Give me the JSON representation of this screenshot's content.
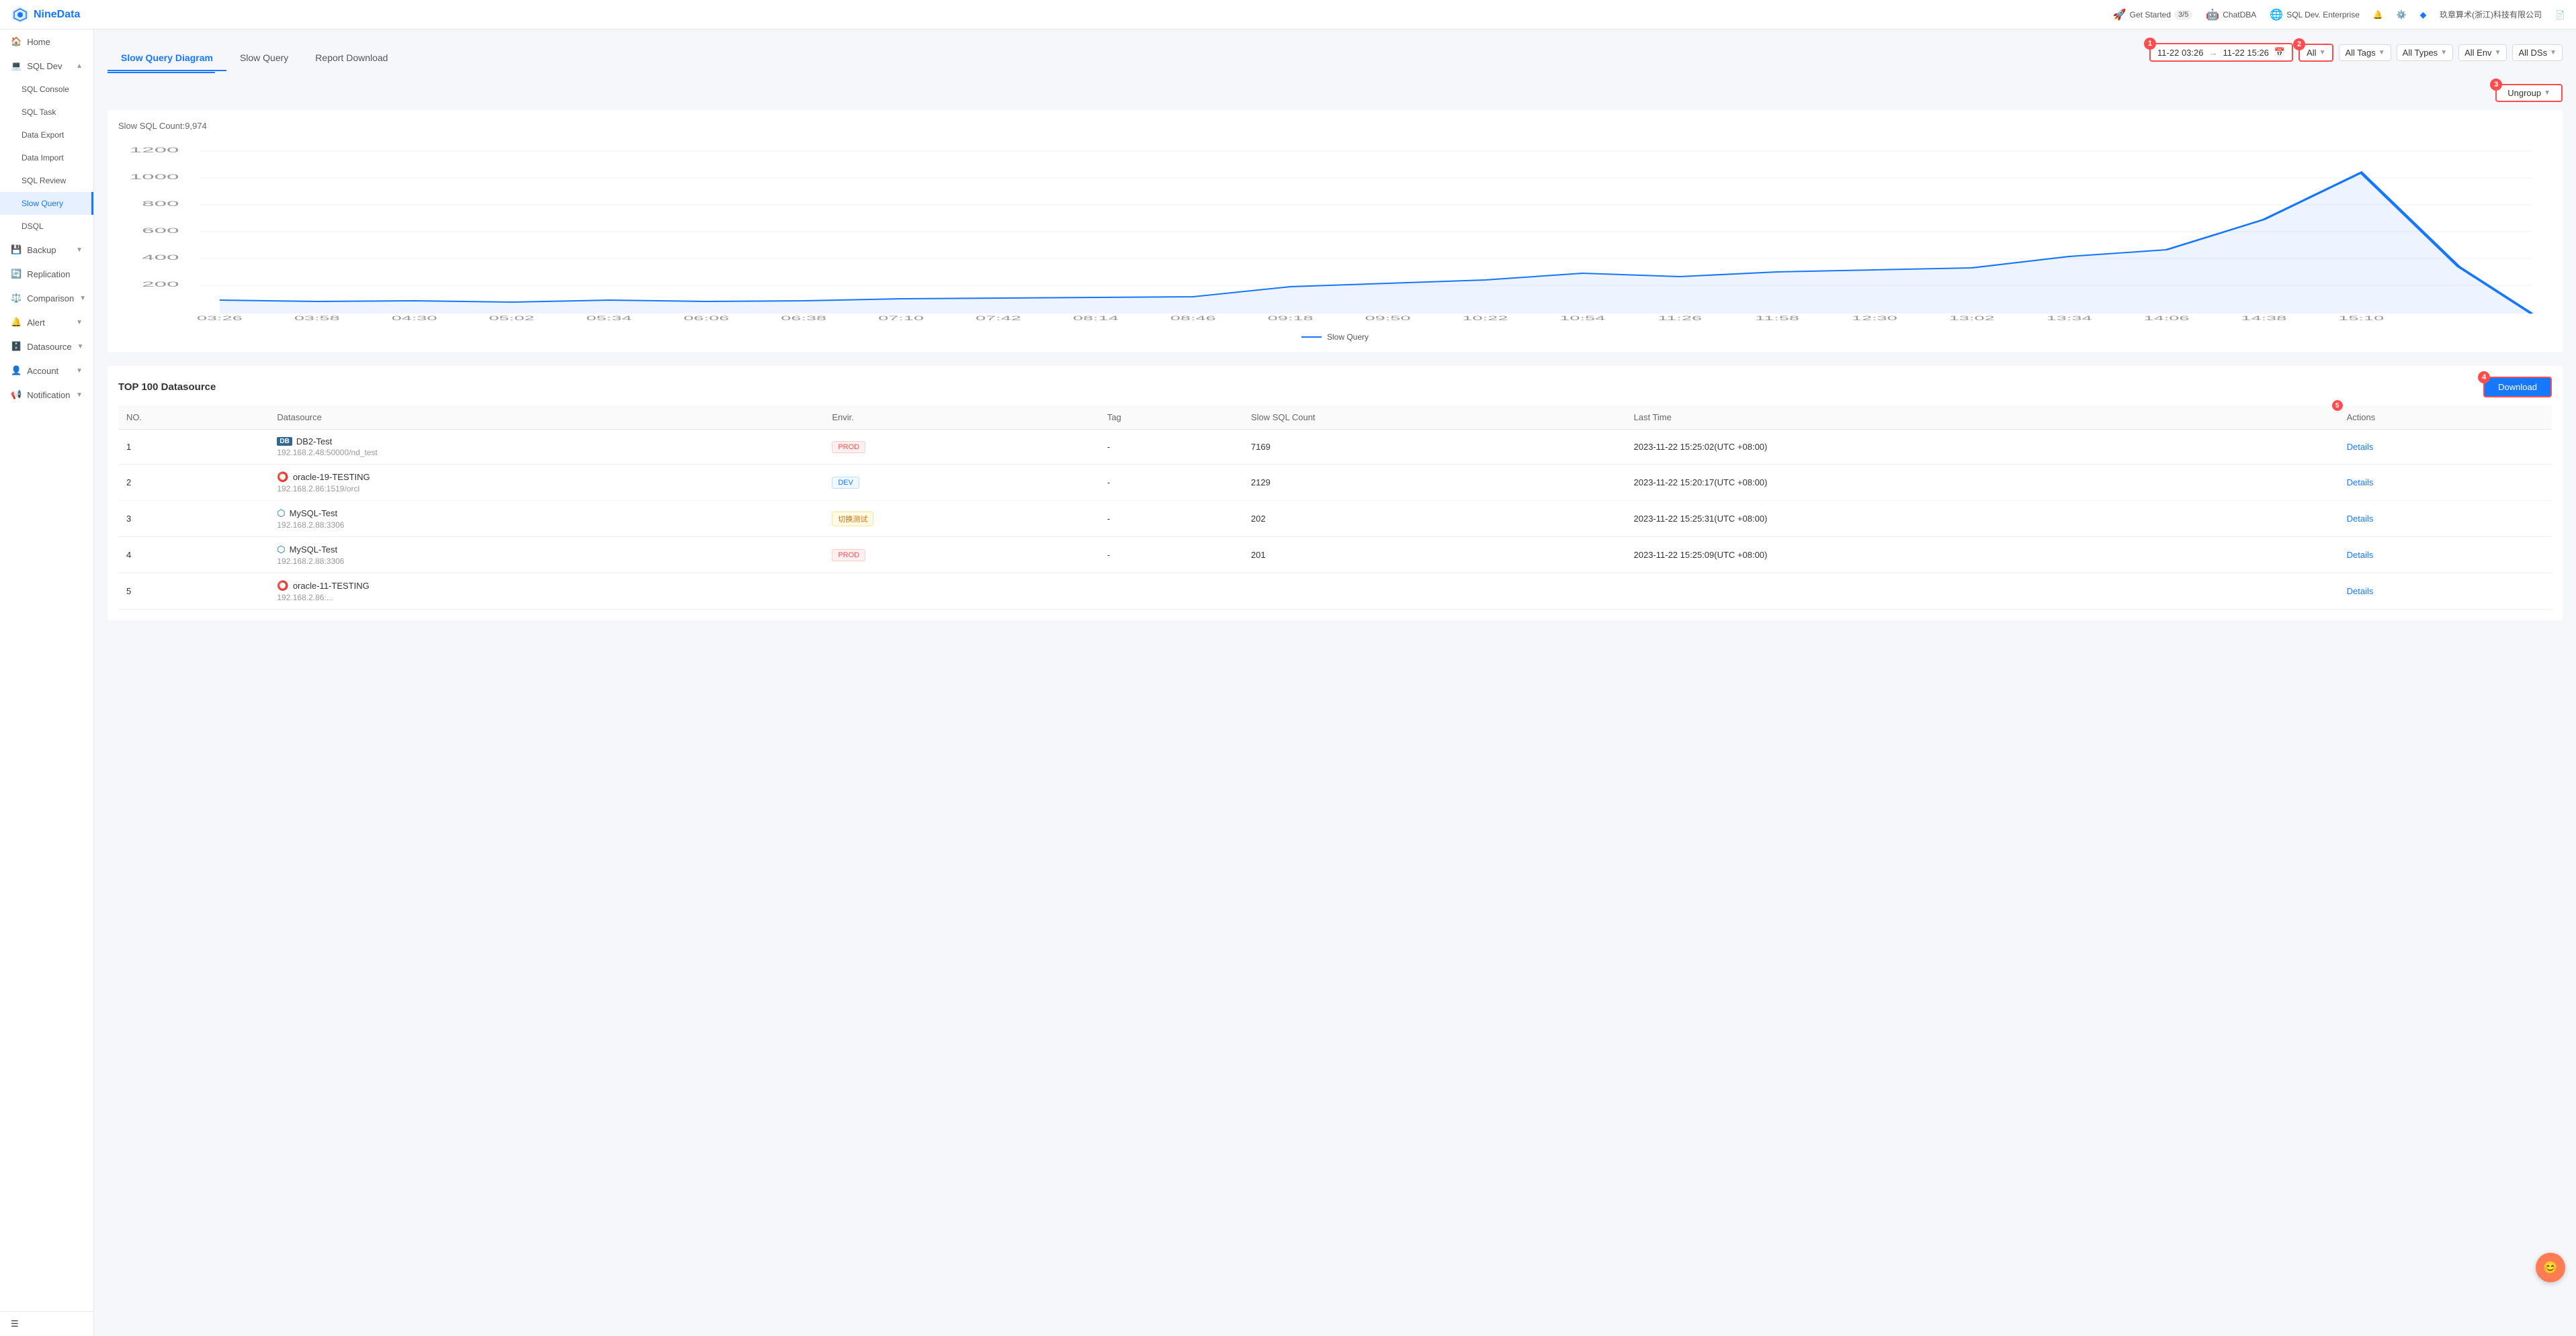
{
  "app": {
    "name": "NineData"
  },
  "topbar": {
    "get_started": "Get Started",
    "get_started_progress": "3/5",
    "chatdba": "ChatDBA",
    "sql_dev": "SQL Dev. Enterprise",
    "company": "玖章算术(浙江)科技有限公司"
  },
  "sidebar": {
    "items": [
      {
        "id": "home",
        "label": "Home",
        "icon": "home"
      },
      {
        "id": "sql-dev",
        "label": "SQL Dev",
        "icon": "code",
        "expanded": true,
        "children": [
          {
            "id": "sql-console",
            "label": "SQL Console"
          },
          {
            "id": "sql-task",
            "label": "SQL Task"
          },
          {
            "id": "data-export",
            "label": "Data Export"
          },
          {
            "id": "data-import",
            "label": "Data Import"
          },
          {
            "id": "sql-review",
            "label": "SQL Review"
          },
          {
            "id": "slow-query",
            "label": "Slow Query",
            "active": true
          },
          {
            "id": "dsql",
            "label": "DSQL"
          }
        ]
      },
      {
        "id": "backup",
        "label": "Backup",
        "icon": "backup",
        "hasChildren": true
      },
      {
        "id": "replication",
        "label": "Replication",
        "icon": "replication"
      },
      {
        "id": "comparison",
        "label": "Comparison",
        "icon": "comparison",
        "hasChildren": true
      },
      {
        "id": "alert",
        "label": "Alert",
        "icon": "alert",
        "hasChildren": true
      },
      {
        "id": "datasource",
        "label": "Datasource",
        "icon": "datasource",
        "hasChildren": true
      },
      {
        "id": "account",
        "label": "Account",
        "icon": "account",
        "hasChildren": true
      },
      {
        "id": "notification",
        "label": "Notification",
        "icon": "notification",
        "hasChildren": true
      }
    ]
  },
  "tabs": [
    {
      "id": "slow-query-diagram",
      "label": "Slow Query Diagram",
      "active": true
    },
    {
      "id": "slow-query",
      "label": "Slow Query"
    },
    {
      "id": "report-download",
      "label": "Report Download"
    }
  ],
  "filters": {
    "date_from": "11-22 03:26",
    "date_to": "11-22 15:26",
    "all_label": "All",
    "all_tags": "All Tags",
    "all_types": "All Types",
    "all_env": "All Env",
    "all_ds": "All DSs"
  },
  "badges": {
    "b1": "1",
    "b2": "2",
    "b3": "3",
    "b4": "4",
    "b5": "5"
  },
  "ungroup": {
    "label": "Ungroup"
  },
  "chart": {
    "slow_sql_count": "Slow SQL Count:9,974",
    "y_labels": [
      "1200",
      "1000",
      "800",
      "600",
      "400",
      "200"
    ],
    "x_labels": [
      "03:26",
      "03:58",
      "04:30",
      "05:02",
      "05:34",
      "06:06",
      "06:38",
      "07:10",
      "07:42",
      "08:14",
      "08:46",
      "09:18",
      "09:50",
      "10:22",
      "10:54",
      "11:26",
      "11:58",
      "12:30",
      "13:02",
      "13:34",
      "14:06",
      "14:38",
      "15:10"
    ],
    "legend": "Slow Query"
  },
  "table": {
    "title": "TOP 100 Datasource",
    "download_label": "Download",
    "columns": [
      "NO.",
      "Datasource",
      "Envir.",
      "Tag",
      "Slow SQL Count",
      "Last Time",
      "Actions"
    ],
    "rows": [
      {
        "no": "1",
        "ds_name": "DB2-Test",
        "ds_addr": "192.168.2.48:50000/nd_test",
        "ds_type": "db2",
        "env": "PROD",
        "env_class": "env-prod",
        "tag": "-",
        "slow_sql_count": "7169",
        "last_time": "2023-11-22 15:25:02(UTC +08:00)",
        "action": "Details"
      },
      {
        "no": "2",
        "ds_name": "oracle-19-TESTING",
        "ds_addr": "192.168.2.86:1519/orcl",
        "ds_type": "oracle",
        "env": "DEV",
        "env_class": "env-dev",
        "tag": "-",
        "slow_sql_count": "2129",
        "last_time": "2023-11-22 15:20:17(UTC +08:00)",
        "action": "Details"
      },
      {
        "no": "3",
        "ds_name": "MySQL-Test",
        "ds_addr": "192.168.2.88:3306",
        "ds_type": "mysql",
        "env": "切换测试",
        "env_class": "env-custom",
        "tag": "-",
        "slow_sql_count": "202",
        "last_time": "2023-11-22 15:25:31(UTC +08:00)",
        "action": "Details"
      },
      {
        "no": "4",
        "ds_name": "MySQL-Test",
        "ds_addr": "192.168.2.88:3306",
        "ds_type": "mysql",
        "env": "PROD",
        "env_class": "env-prod",
        "tag": "-",
        "slow_sql_count": "201",
        "last_time": "2023-11-22 15:25:09(UTC +08:00)",
        "action": "Details"
      },
      {
        "no": "5",
        "ds_name": "oracle-11-TESTING",
        "ds_addr": "192.168.2.86:...",
        "ds_type": "oracle",
        "env": "",
        "env_class": "",
        "tag": "-",
        "slow_sql_count": "",
        "last_time": "",
        "action": "Details"
      }
    ]
  }
}
